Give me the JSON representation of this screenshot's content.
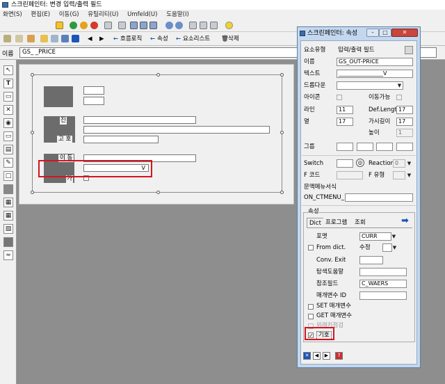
{
  "window": {
    "title": "스크린페인터: 변경 입력/출력 필드"
  },
  "menubar": [
    "화면(S)",
    "편집(E)",
    "이동(G)",
    "유틸리티(U)",
    "Umfeld(U)",
    "도움말(I)"
  ],
  "toolbar2": {
    "items": [
      {
        "glyph": "←",
        "label": "흐름로직"
      },
      {
        "glyph": "←",
        "label": "속성"
      },
      {
        "glyph": "←",
        "label": "요소리스트"
      },
      {
        "glyph": "🗑",
        "label": "삭제"
      }
    ]
  },
  "namebar": {
    "label": "이름",
    "value": "GS_    _PRICE"
  },
  "canvas": {
    "labels": {
      "l1": "진",
      "l2": "고 호",
      "l3": "이 동",
      "l4": "가"
    },
    "input_value_marker": "V"
  },
  "dialog": {
    "title": "스크린페인터: 속성",
    "fields": {
      "element_type_label": "요소유형",
      "element_type_value": "입력/출력 필드",
      "name_label": "이름",
      "name_value": "GS_OUT-PRICE",
      "text_label": "텍스트",
      "text_value": "________________V",
      "dropdown_label": "드롭다운",
      "icon_label": "아이콘",
      "movable_label": "이동가능",
      "line_label": "라인",
      "line_value": "11",
      "deflength_label": "Def.Length",
      "deflength_value": "17",
      "column_label": "열",
      "column_value": "17",
      "visible_length_label": "가시길이",
      "visible_length_value": "17",
      "height_label": "높이",
      "height_value": "1",
      "group_label": "그룹",
      "switch_label": "Switch",
      "reaction_label": "Reaction",
      "reaction_value": "0",
      "fcode_label": "F 코드",
      "ftype_label": "F 유형",
      "context_menu_label": "문맥메뉴서식",
      "context_menu_value": "ON_CTMENU_"
    },
    "attributes": {
      "section_label": "속성",
      "tabs": [
        "Dict",
        "프로그램",
        "조회"
      ],
      "format_label": "포맷",
      "format_value": "CURR",
      "from_dict_label": "From dict.",
      "modify_label": "수정",
      "conv_exit_label": "Conv. Exit",
      "search_help_label": "탐색도움말",
      "ref_field_label": "참조필드",
      "ref_field_value": "C_WAERS",
      "param_id_label": "매개변수 ID",
      "set_param_label": "SET 매개변수",
      "get_param_label": "GET 매개변수",
      "foreign_key_label": "외래키점검",
      "sign_label": "기호"
    },
    "checks": {
      "from_dict": false,
      "set_param": false,
      "get_param": false,
      "foreign_key": false,
      "sign": true
    }
  },
  "colors": {
    "highlight": "#d4141f",
    "dialog_frame": "#c3d8ef",
    "canvas_bg": "#8e8e8e"
  }
}
